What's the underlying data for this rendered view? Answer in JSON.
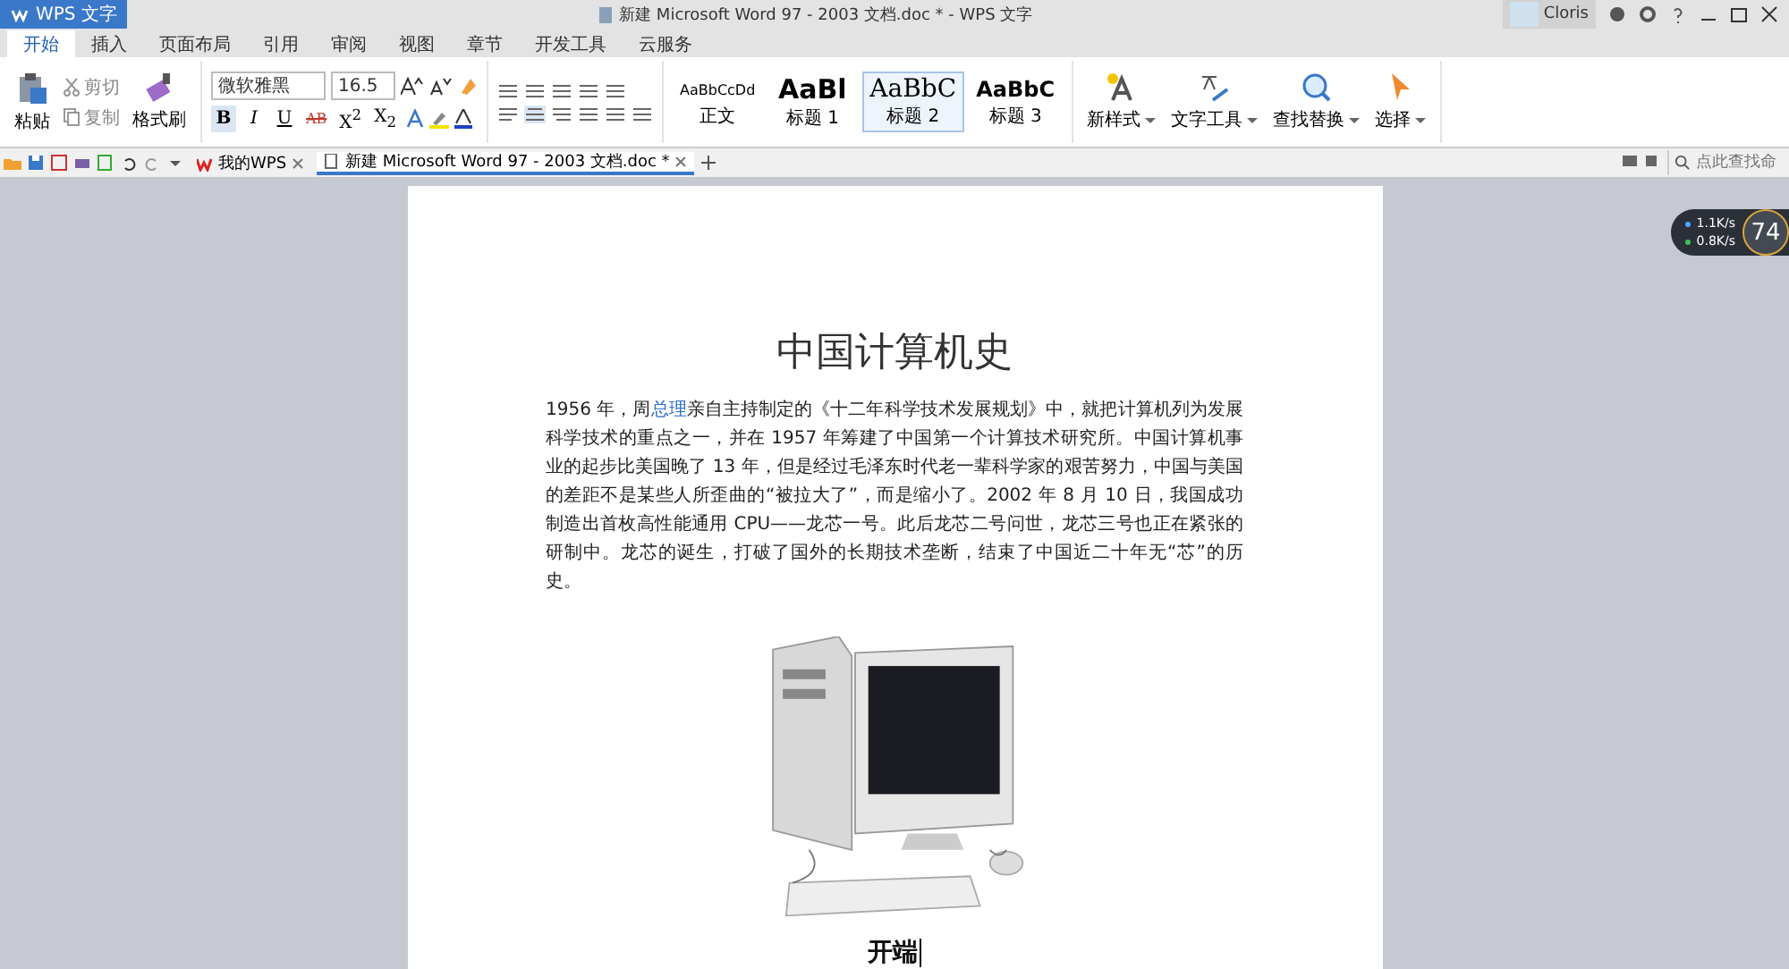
{
  "window": {
    "app_button": "WPS 文字",
    "title": "新建 Microsoft Word 97 - 2003 文档.doc * - WPS 文字",
    "user": "Cloris"
  },
  "ribbon_tabs": [
    {
      "label": "开始",
      "selected": true
    },
    {
      "label": "插入",
      "selected": false
    },
    {
      "label": "页面布局",
      "selected": false
    },
    {
      "label": "引用",
      "selected": false
    },
    {
      "label": "审阅",
      "selected": false
    },
    {
      "label": "视图",
      "selected": false
    },
    {
      "label": "章节",
      "selected": false
    },
    {
      "label": "开发工具",
      "selected": false
    },
    {
      "label": "云服务",
      "selected": false
    }
  ],
  "ribbon": {
    "clipboard": {
      "paste": "粘贴",
      "cut": "剪切",
      "copy": "复制",
      "format_painter": "格式刷"
    },
    "font": {
      "name": "微软雅黑",
      "size": "16.5",
      "buttons": [
        "B",
        "I",
        "U",
        "AB",
        "X$^{2}$",
        "X$_{2}$"
      ]
    },
    "styles": [
      {
        "preview": "AaBbCcDd",
        "label": "正文",
        "selected": false
      },
      {
        "preview": "AaBl",
        "label": "标题 1",
        "selected": false
      },
      {
        "preview": "AaBbC",
        "label": "标题 2",
        "selected": true
      },
      {
        "preview": "AaBbC",
        "label": "标题 3",
        "selected": false
      }
    ],
    "tools": [
      "新样式",
      "文字工具",
      "查找替换",
      "选择"
    ]
  },
  "document_tabs": [
    {
      "label": "我的WPS",
      "selected": false
    },
    {
      "label": "新建 Microsoft Word 97 - 2003 文档.doc *",
      "selected": true
    }
  ],
  "command_search": {
    "placeholder": "点此查找命"
  },
  "network_widget": {
    "upload": "1.1K/s",
    "download": "0.8K/s",
    "value": "74"
  },
  "document": {
    "title": "中国计算机史",
    "paragraph": [
      {
        "text": "1956 年，周",
        "kind": "plain"
      },
      {
        "text": "总理",
        "kind": "link"
      },
      {
        "text": "亲自主持制定的《十二年科学技术发展规划》中，就把计算机列为发展科学技术的重点之一，并在 1957 年筹建了中国第一个计算技术研究所。中国计算机事业的起步比美国晚了 13 年，但是经过毛泽东时代老一辈科学家的艰苦努力，中国与美国的差距不是某些人所歪曲的“被拉大了”，而是缩小了。2002 年 8 月 10 日，我国成功制造出首枚高性能通用 CPU——龙芯一号。此后龙芯二号问世，龙芯三号也正在紧张的研制中。龙芯的诞生，打破了国外的长期技术垄断，结束了中国近二十年无“芯”的历史。",
        "kind": "plain"
      }
    ],
    "heading": "开端"
  }
}
